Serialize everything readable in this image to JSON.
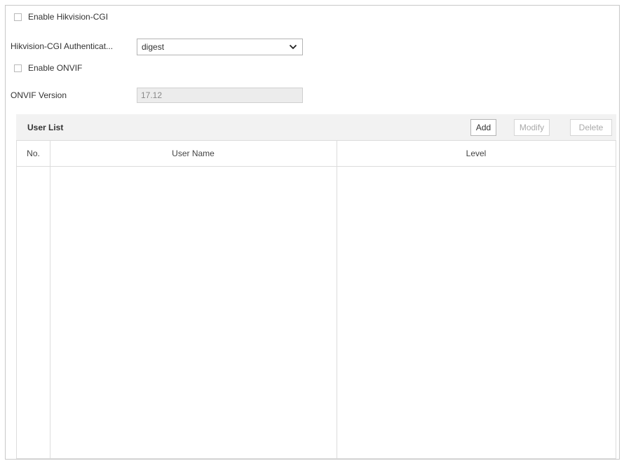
{
  "settings": {
    "enable_cgi_label": "Enable Hikvision-CGI",
    "cgi_auth_label": "Hikvision-CGI Authenticat...",
    "cgi_auth_value": "digest",
    "enable_onvif_label": "Enable ONVIF",
    "onvif_version_label": "ONVIF Version",
    "onvif_version_value": "17.12"
  },
  "user_list": {
    "title": "User List",
    "add_label": "Add",
    "modify_label": "Modify",
    "delete_label": "Delete",
    "columns": [
      "No.",
      "User Name",
      "Level"
    ],
    "rows": []
  },
  "icons": {
    "select_arrow": "chevron-down-icon"
  }
}
